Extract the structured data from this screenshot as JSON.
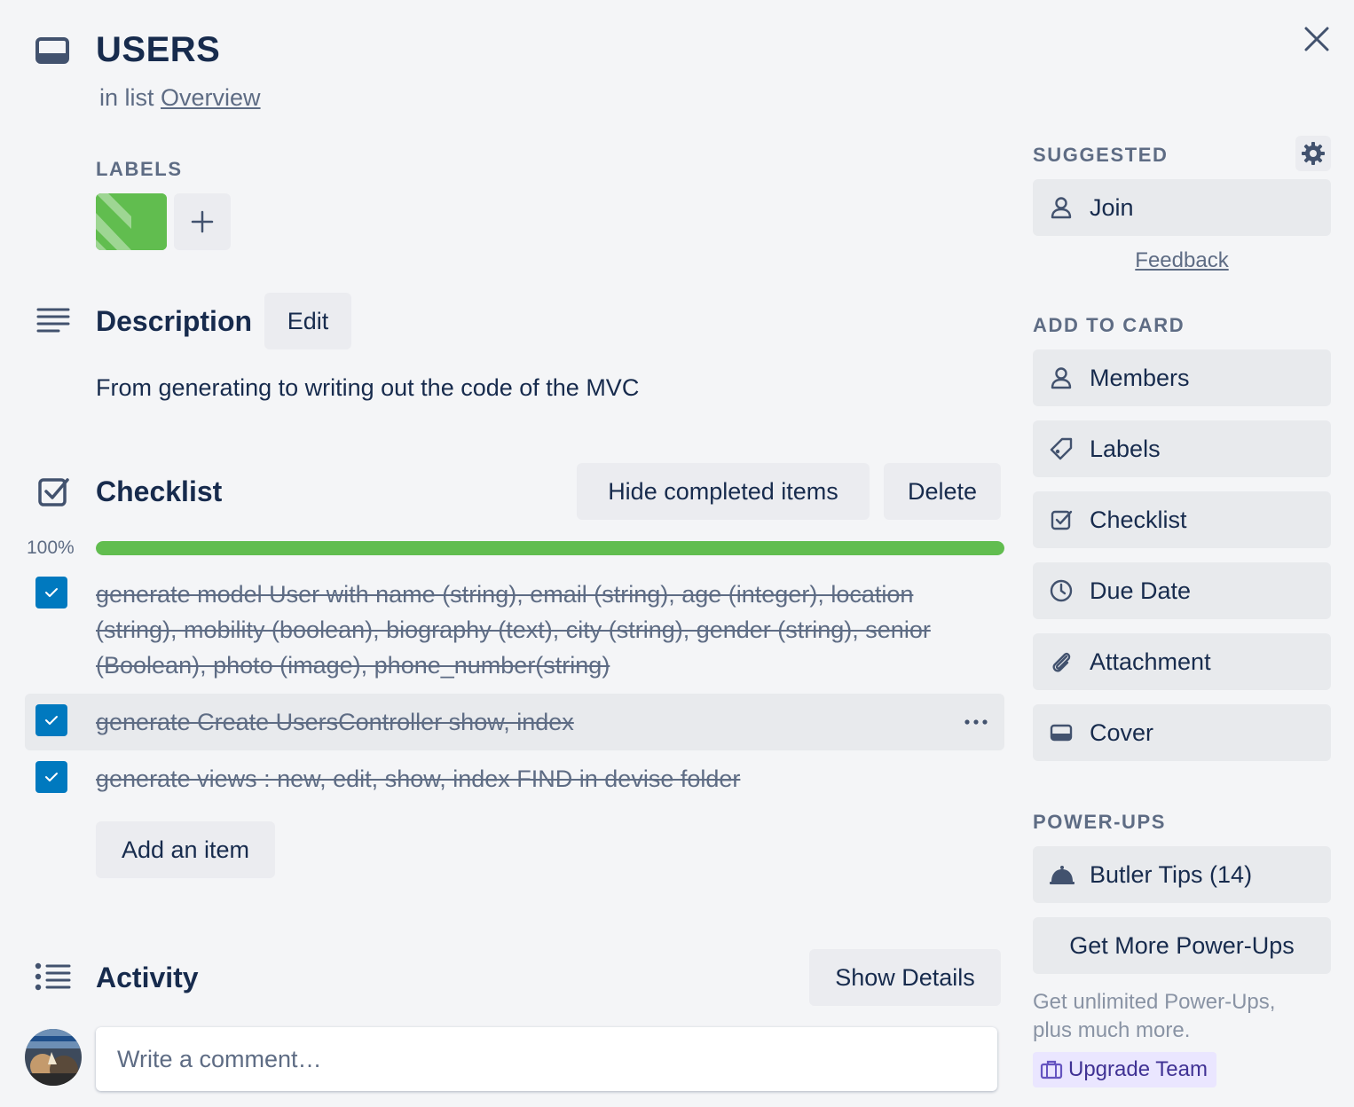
{
  "header": {
    "title": "USERS",
    "list_prefix": "in list",
    "list_name": "Overview"
  },
  "labels": {
    "heading": "LABELS",
    "chip_color": "#61bd4f"
  },
  "description": {
    "heading": "Description",
    "edit_label": "Edit",
    "text": "From generating to writing out the code of the MVC"
  },
  "checklist": {
    "heading": "Checklist",
    "hide_completed_label": "Hide completed items",
    "delete_label": "Delete",
    "percent_label": "100%",
    "progress": 1.0,
    "items": [
      {
        "text": "generate model User with name (string), email (string), age (integer), location (string), mobility (boolean), biography (text), city (string), gender (string), senior (Boolean), photo (image), phone_number(string)",
        "checked": true
      },
      {
        "text": "generate Create UsersController show, index",
        "checked": true
      },
      {
        "text": "generate views : new, edit, show, index FIND in devise folder",
        "checked": true
      }
    ],
    "add_item_label": "Add an item"
  },
  "activity": {
    "heading": "Activity",
    "show_details_label": "Show Details",
    "comment_placeholder": "Write a comment…"
  },
  "sidebar": {
    "suggested_heading": "SUGGESTED",
    "join_label": "Join",
    "feedback_label": "Feedback",
    "add_to_card_heading": "ADD TO CARD",
    "add_to_card": [
      {
        "label": "Members",
        "icon": "person-icon"
      },
      {
        "label": "Labels",
        "icon": "tag-icon"
      },
      {
        "label": "Checklist",
        "icon": "checklist-icon"
      },
      {
        "label": "Due Date",
        "icon": "clock-icon"
      },
      {
        "label": "Attachment",
        "icon": "paperclip-icon"
      },
      {
        "label": "Cover",
        "icon": "cover-icon"
      }
    ],
    "powerups_heading": "POWER-UPS",
    "butler_label": "Butler Tips (14)",
    "get_more_label": "Get More Power-Ups",
    "promo_text": "Get unlimited Power-Ups, plus much more.",
    "upgrade_label": "Upgrade Team"
  },
  "colors": {
    "accent_blue": "#0079bf",
    "success_green": "#61bd4f",
    "text_dark": "#172b4d",
    "text_muted": "#5e6c84"
  }
}
